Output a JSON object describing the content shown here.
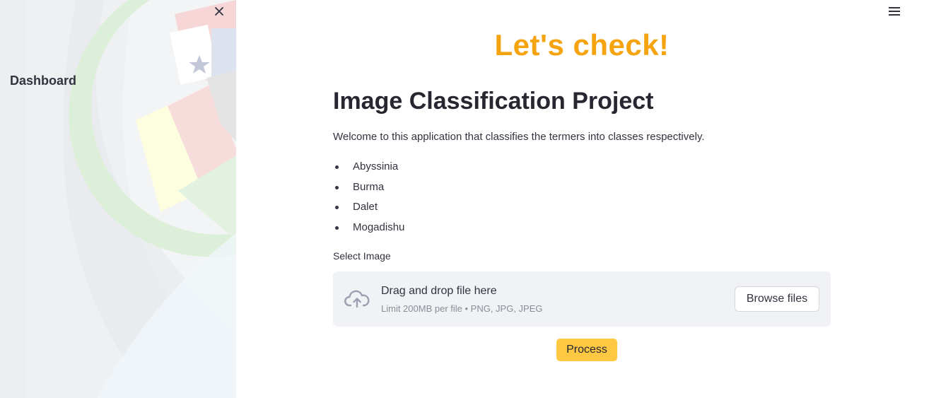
{
  "sidebar": {
    "title": "Dashboard",
    "close_icon": "close-icon"
  },
  "header": {
    "menu_icon": "hamburger-menu-icon"
  },
  "main": {
    "hero": "Let's check!",
    "title": "Image Classification Project",
    "intro": "Welcome to this application that classifies the termers into classes respectively.",
    "classes": [
      "Abyssinia",
      "Burma",
      "Dalet",
      "Mogadishu"
    ],
    "upload": {
      "label": "Select Image",
      "drop_title": "Drag and drop file here",
      "drop_sub": "Limit 200MB per file • PNG, JPG, JPEG",
      "browse_label": "Browse files",
      "icon": "cloud-upload-icon"
    },
    "process_label": "Process"
  },
  "colors": {
    "accent_orange": "#f5a30e",
    "process_button": "#ffc843",
    "sidebar_bg": "#f0f2f6"
  }
}
